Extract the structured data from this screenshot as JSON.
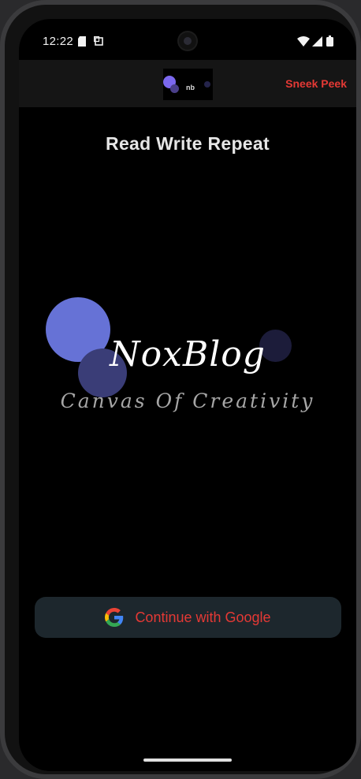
{
  "status_bar": {
    "time": "12:22",
    "icons": [
      "sd-card-icon",
      "screenshot-icon",
      "wifi-icon",
      "signal-icon",
      "battery-icon"
    ]
  },
  "app_bar": {
    "logo_text": "nb",
    "action_label": "Sneek Peek"
  },
  "headline": "Read Write Repeat",
  "hero": {
    "brand": "NoxBlog",
    "tagline": "Canvas Of Creativity"
  },
  "google_button": {
    "label": "Continue with Google",
    "icon": "google-icon"
  },
  "colors": {
    "accent": "#e53935",
    "primary_circle": "#6672d6",
    "button_bg": "#1d272d",
    "background": "#000000"
  }
}
